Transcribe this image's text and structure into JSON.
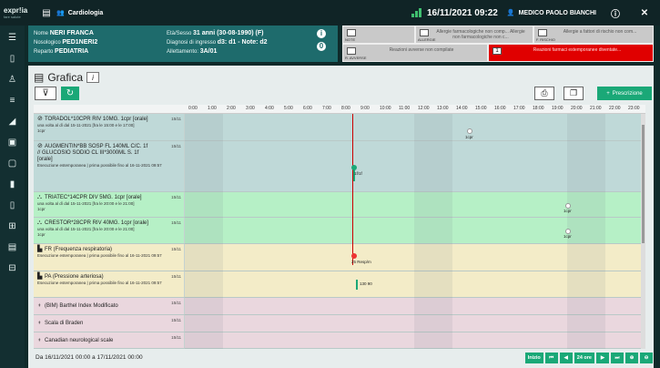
{
  "topbar": {
    "brand": "expr!ia",
    "brand_sub": "fare salute",
    "department": "Cardiologia",
    "datetime": "16/11/2021 09:22",
    "user": "MEDICO PAOLO BIANCHI"
  },
  "patient": {
    "name_label": "Nome",
    "name": "NERI FRANCA",
    "nosologico_label": "Nosologico",
    "nosologico": "PED1NERI2",
    "reparto_label": "Reparto",
    "reparto": "PEDIATRIA",
    "eta_label": "Età/Sesso",
    "eta": "31 anni (30-08-1990) (F)",
    "diagnosi_label": "Diagnosi di ingresso",
    "diagnosi": "d3: d1 - Note: d2",
    "allettamento_label": "Allettamento:",
    "allettamento": "3A/01",
    "badge_count": "0"
  },
  "alerts": [
    {
      "label": "NOTE",
      "text": ""
    },
    {
      "label": "ALLERGIE",
      "text": "Allergie farmacologiche non comp... Allergie non farmacologiche non c..."
    },
    {
      "label": "F. RISCHIO",
      "text": "Allergie a fattori di rischio non com..."
    },
    {
      "label": "R. AVVERSE",
      "text": "Reazioni avverse non compilate"
    },
    {
      "label": "",
      "text": "Reazioni farmaci estemporanee diventate...",
      "count": "1"
    }
  ],
  "panel": {
    "title": "Grafica",
    "info": "i",
    "prescrizione_label": "Prescrizione"
  },
  "hours": [
    "0:00",
    "1:00",
    "2:00",
    "3:00",
    "4:00",
    "5:00",
    "6:00",
    "7:00",
    "8:00",
    "9:00",
    "10:00",
    "11:00",
    "12:00",
    "13:00",
    "14:00",
    "15:00",
    "16:00",
    "17:00",
    "18:00",
    "19:00",
    "20:00",
    "21:00",
    "22:00",
    "23:00"
  ],
  "rows": [
    {
      "title": "TORADOL*10CPR RIV 10MG. 1cpr [orale]",
      "sub": "una volta al dì dal 15-11-2021 [fra le 15:00 e le 17:00]",
      "sub2": "1cpr",
      "date": "15/11"
    },
    {
      "title": "AUGMENTIN*BB SOSP FL 140ML C/C. 1f",
      "title2": "// GLUCOSIO SODIO CL III*3000ML S. 1f",
      "title3": "[orale]",
      "sub": "Esecuzione estemporanea | prima possibile fino al 16-11-2021 09:57",
      "date": "15/11"
    },
    {
      "title": "TRIATEC*14CPR DIV 5MG. 1cpr [orale]",
      "sub": "una volta al dì dal 15-11-2021 [fra le 20:00 e le 21:00]",
      "sub2": "1cpr",
      "date": "15/11"
    },
    {
      "title": "CRESTOR*28CPR RIV 40MG. 1cpr [orale]",
      "sub": "una volta al dì dal 15-11-2021 [fra le 20:00 e le 21:00]",
      "sub2": "1cpr",
      "date": "15/11"
    },
    {
      "title": "FR (Frequenza respiratoria)",
      "sub": "Esecuzione estemporanea | prima possibile fino al 16-11-2021 09:57",
      "date": "15/11"
    },
    {
      "title": "PA (Pressione arteriosa)",
      "sub": "Esecuzione estemporanea | prima possibile fino al 16-11-2021 09:57",
      "date": "15/11"
    },
    {
      "title": "(BIM) Barthel Index Modificato",
      "date": "15/11"
    },
    {
      "title": "Scala di Braden",
      "date": "15/11"
    },
    {
      "title": "Canadian neurological scale",
      "date": "15/11"
    }
  ],
  "markers": {
    "toradol": "1cpr",
    "augmentin": "1f/1f",
    "triatec": "1cpr",
    "crestor": "1cpr",
    "fr": "25 Resp/m",
    "pa": "130 90"
  },
  "footer": {
    "range": "Da 16/11/2021 00:00 a 17/11/2021 00:00",
    "inizio": "Inizio",
    "hours24": "24 ore"
  },
  "colors": {
    "accent": "#1aa877",
    "header": "#1e6b6c",
    "alert_red": "#e00000"
  }
}
